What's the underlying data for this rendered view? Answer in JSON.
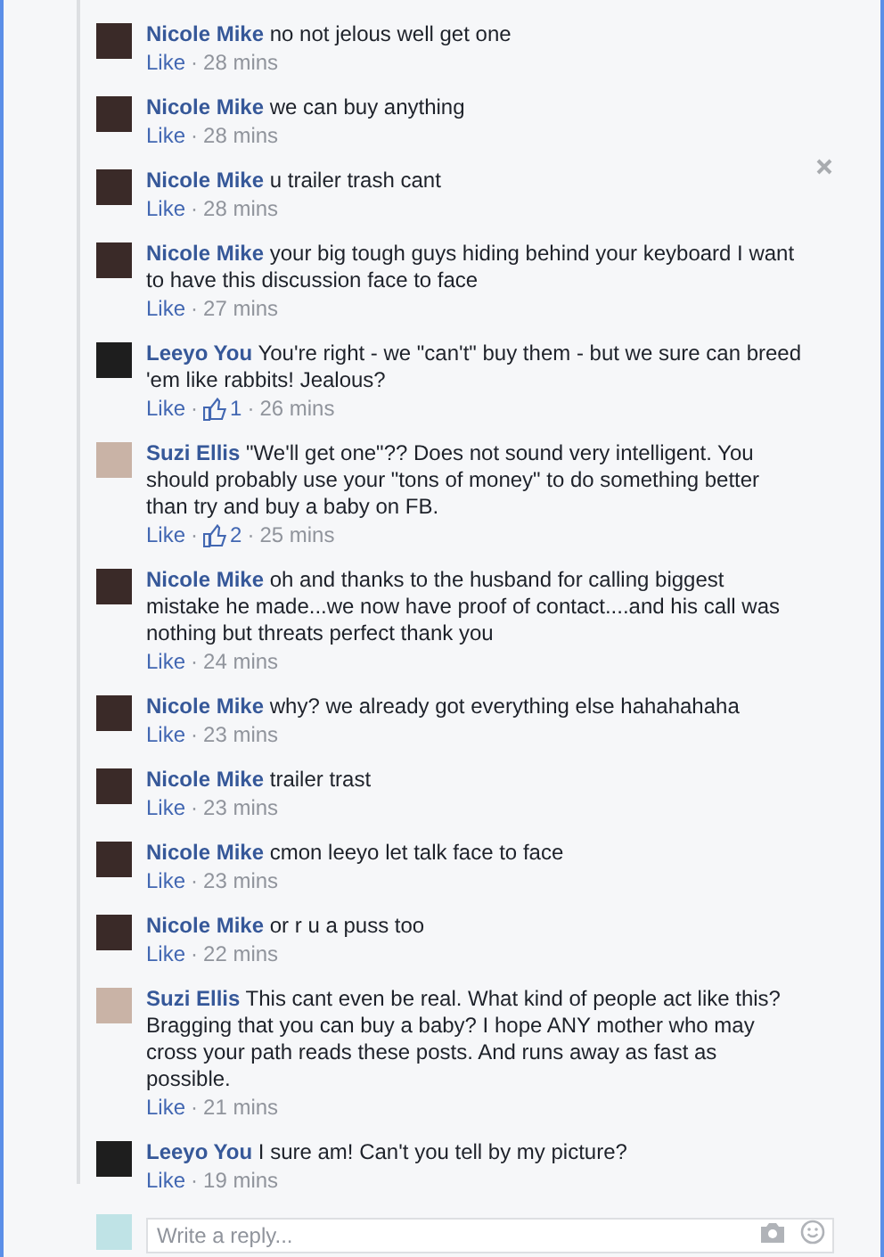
{
  "comments": [
    {
      "author": "Nicole Mike",
      "text": "no not jelous well get one",
      "like": "Like",
      "sep": "·",
      "time": "28 mins"
    },
    {
      "author": "Nicole Mike",
      "text": "we can buy anything",
      "like": "Like",
      "sep": "·",
      "time": "28 mins"
    },
    {
      "author": "Nicole Mike",
      "text": "u trailer trash cant",
      "like": "Like",
      "sep": "·",
      "time": "28 mins"
    },
    {
      "author": "Nicole Mike",
      "text": "your big tough guys hiding behind your keyboard I want to have this discussion face to face",
      "like": "Like",
      "sep": "·",
      "time": "27 mins"
    },
    {
      "author": "Leeyo You",
      "text": "You're right - we \"can't\" buy them - but we sure can breed 'em like rabbits! Jealous?",
      "like": "Like",
      "sep": "·",
      "likes": "1",
      "sep2": "·",
      "time": "26 mins"
    },
    {
      "author": "Suzi Ellis",
      "text": "\"We'll get one\"?? Does not sound very intelligent. You should probably use your \"tons of money\" to do something better than try and buy a baby on FB.",
      "like": "Like",
      "sep": "·",
      "likes": "2",
      "sep2": "·",
      "time": "25 mins"
    },
    {
      "author": "Nicole Mike",
      "text": "oh and thanks to the husband for calling biggest mistake he made...we now have proof of contact....and his call was nothing but threats perfect thank you",
      "like": "Like",
      "sep": "·",
      "time": "24 mins"
    },
    {
      "author": "Nicole Mike",
      "text": "why? we already got everything else hahahahaha",
      "like": "Like",
      "sep": "·",
      "time": "23 mins"
    },
    {
      "author": "Nicole Mike",
      "text": "trailer trast",
      "like": "Like",
      "sep": "·",
      "time": "23 mins"
    },
    {
      "author": "Nicole Mike",
      "text": "cmon leeyo let talk face to face",
      "like": "Like",
      "sep": "·",
      "time": "23 mins"
    },
    {
      "author": "Nicole Mike",
      "text": "or r u a puss too",
      "like": "Like",
      "sep": "·",
      "time": "22 mins"
    },
    {
      "author": "Suzi Ellis",
      "text": "This cant even be real. What kind of people act like this? Bragging that you can buy a baby? I hope ANY mother who may cross your path reads these posts. And runs away as fast as possible.",
      "like": "Like",
      "sep": "·",
      "time": "21 mins"
    },
    {
      "author": "Leeyo You",
      "text": "I sure am! Can't you tell by my picture?",
      "like": "Like",
      "sep": "·",
      "time": "19 mins"
    }
  ],
  "reply": {
    "placeholder": "Write a reply..."
  }
}
